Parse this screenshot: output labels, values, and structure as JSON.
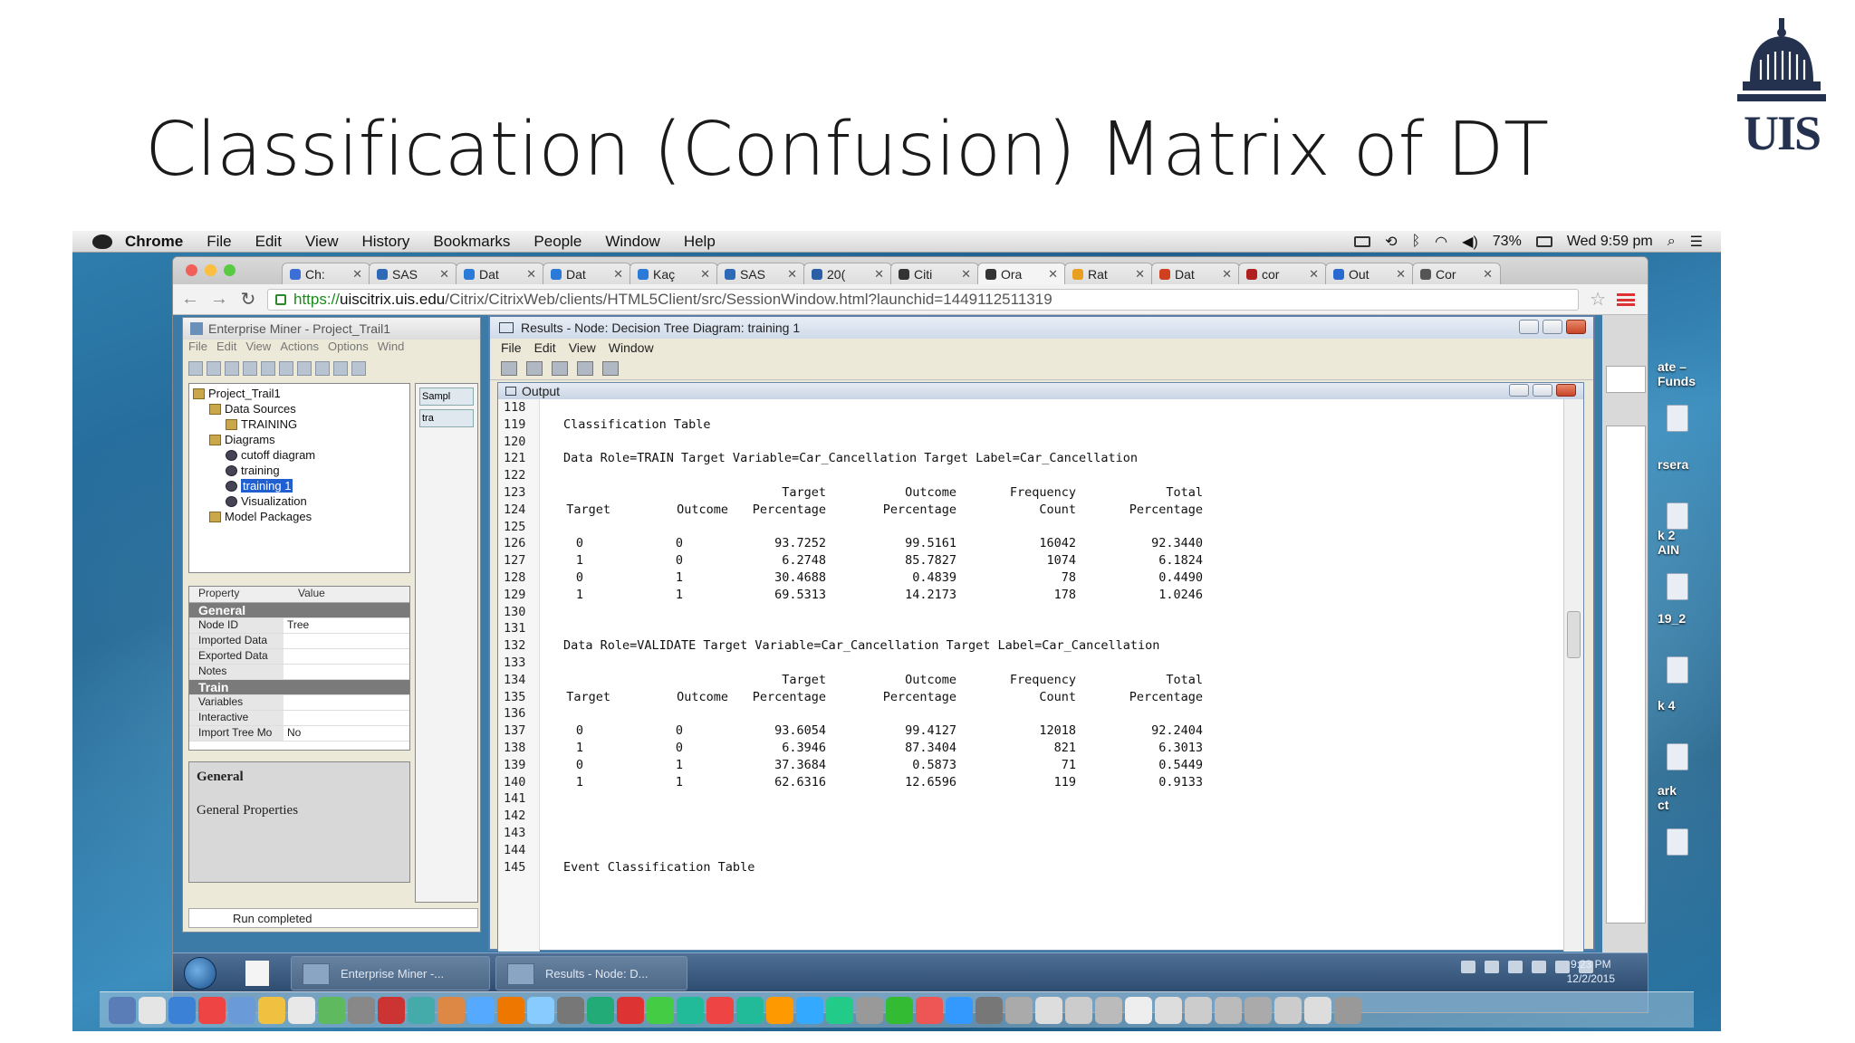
{
  "slide": {
    "title": "Classification (Confusion) Matrix of DT",
    "logo_text": "UIS"
  },
  "mac_menubar": {
    "app": "Chrome",
    "items": [
      "File",
      "Edit",
      "View",
      "History",
      "Bookmarks",
      "People",
      "Window",
      "Help"
    ],
    "battery": "73%",
    "clock": "Wed 9:59 pm"
  },
  "chrome": {
    "tabs": [
      {
        "label": "Ch:",
        "color": "#3b6fd6"
      },
      {
        "label": "SAS",
        "color": "#2c6ab8"
      },
      {
        "label": "Dat",
        "color": "#2a7ad8"
      },
      {
        "label": "Dat",
        "color": "#2a7ad8"
      },
      {
        "label": "Kaç",
        "color": "#2a7ad8"
      },
      {
        "label": "SAS",
        "color": "#2c6ab8"
      },
      {
        "label": "20(",
        "color": "#2a5fa8"
      },
      {
        "label": "Citi",
        "color": "#333333"
      },
      {
        "label": "Ora",
        "color": "#333333"
      },
      {
        "label": "Rat",
        "color": "#e8a020"
      },
      {
        "label": "Dat",
        "color": "#d04020"
      },
      {
        "label": "cor",
        "color": "#b02020"
      },
      {
        "label": "Out",
        "color": "#2a6ad0"
      },
      {
        "label": "Cor",
        "color": "#555555"
      }
    ],
    "active_tab_index": 8,
    "url_https": "https://",
    "url_domain": "uiscitrix.uis.edu",
    "url_rest": "/Citrix/CitrixWeb/clients/HTML5Client/src/SessionWindow.html?launchid=1449112511319"
  },
  "em": {
    "title": "Enterprise Miner - Project_Trail1",
    "menu": [
      "File",
      "Edit",
      "View",
      "Actions",
      "Options",
      "Wind"
    ],
    "tree": [
      {
        "label": "Project_Trail1",
        "indent": 0,
        "gear": false,
        "selected": false
      },
      {
        "label": "Data Sources",
        "indent": 1,
        "gear": false,
        "selected": false
      },
      {
        "label": "TRAINING",
        "indent": 2,
        "gear": false,
        "selected": false
      },
      {
        "label": "Diagrams",
        "indent": 1,
        "gear": false,
        "selected": false
      },
      {
        "label": "cutoff diagram",
        "indent": 2,
        "gear": true,
        "selected": false
      },
      {
        "label": "training",
        "indent": 2,
        "gear": true,
        "selected": false
      },
      {
        "label": "training 1",
        "indent": 2,
        "gear": true,
        "selected": true
      },
      {
        "label": "Visualization",
        "indent": 2,
        "gear": true,
        "selected": false
      },
      {
        "label": "Model Packages",
        "indent": 1,
        "gear": false,
        "selected": false
      }
    ],
    "props_header": {
      "property": "Property",
      "value": "Value"
    },
    "props": [
      {
        "k": "General",
        "v": "",
        "section": true
      },
      {
        "k": "Node ID",
        "v": "Tree",
        "section": false
      },
      {
        "k": "Imported Data",
        "v": "",
        "section": false
      },
      {
        "k": "Exported Data",
        "v": "",
        "section": false
      },
      {
        "k": "Notes",
        "v": "",
        "section": false
      },
      {
        "k": "Train",
        "v": "",
        "section": true
      },
      {
        "k": "Variables",
        "v": "",
        "section": false
      },
      {
        "k": "Interactive",
        "v": "",
        "section": false
      },
      {
        "k": "Import Tree Mo",
        "v": "No",
        "section": false
      }
    ],
    "general_heading": "General",
    "general_sub": "General Properties",
    "status": "Run completed",
    "diagram_tabs": [
      "Sampl",
      "tra"
    ]
  },
  "results": {
    "title": "Results - Node: Decision Tree Diagram: training 1",
    "menu": [
      "File",
      "Edit",
      "View",
      "Window"
    ],
    "output_title": "Output"
  },
  "output": {
    "header_cols": {
      "target": "Target",
      "outcome": "Outcome",
      "target_pct": [
        "Target",
        "Percentage"
      ],
      "outcome_pct": [
        "Outcome",
        "Percentage"
      ],
      "freq": [
        "Frequency",
        "Count"
      ],
      "total_pct": [
        "Total",
        "Percentage"
      ]
    },
    "lines": [
      {
        "n": "118",
        "text": ""
      },
      {
        "n": "119",
        "text": "Classification Table"
      },
      {
        "n": "120",
        "text": ""
      },
      {
        "n": "121",
        "text": "Data Role=TRAIN Target Variable=Car_Cancellation Target Label=Car_Cancellation"
      },
      {
        "n": "122",
        "text": ""
      },
      {
        "n": "123",
        "header": 1
      },
      {
        "n": "124",
        "header": 2
      },
      {
        "n": "125",
        "text": ""
      },
      {
        "n": "126",
        "row": [
          "0",
          "0",
          "93.7252",
          "99.5161",
          "16042",
          "92.3440"
        ]
      },
      {
        "n": "127",
        "row": [
          "1",
          "0",
          "6.2748",
          "85.7827",
          "1074",
          "6.1824"
        ]
      },
      {
        "n": "128",
        "row": [
          "0",
          "1",
          "30.4688",
          "0.4839",
          "78",
          "0.4490"
        ]
      },
      {
        "n": "129",
        "row": [
          "1",
          "1",
          "69.5313",
          "14.2173",
          "178",
          "1.0246"
        ]
      },
      {
        "n": "130",
        "text": ""
      },
      {
        "n": "131",
        "text": ""
      },
      {
        "n": "132",
        "text": "Data Role=VALIDATE Target Variable=Car_Cancellation Target Label=Car_Cancellation"
      },
      {
        "n": "133",
        "text": ""
      },
      {
        "n": "134",
        "header": 1
      },
      {
        "n": "135",
        "header": 2
      },
      {
        "n": "136",
        "text": ""
      },
      {
        "n": "137",
        "row": [
          "0",
          "0",
          "93.6054",
          "99.4127",
          "12018",
          "92.2404"
        ]
      },
      {
        "n": "138",
        "row": [
          "1",
          "0",
          "6.3946",
          "87.3404",
          "821",
          "6.3013"
        ]
      },
      {
        "n": "139",
        "row": [
          "0",
          "1",
          "37.3684",
          "0.5873",
          "71",
          "0.5449"
        ]
      },
      {
        "n": "140",
        "row": [
          "1",
          "1",
          "62.6316",
          "12.6596",
          "119",
          "0.9133"
        ]
      },
      {
        "n": "141",
        "text": ""
      },
      {
        "n": "142",
        "text": ""
      },
      {
        "n": "143",
        "text": ""
      },
      {
        "n": "144",
        "text": ""
      },
      {
        "n": "145",
        "text": "Event Classification Table"
      }
    ]
  },
  "taskbar": {
    "items": [
      {
        "label": "Enterprise Miner -..."
      },
      {
        "label": "Results - Node: D..."
      }
    ],
    "time": "9:23 PM",
    "date": "12/2/2015"
  },
  "desktop_labels": [
    {
      "text": "ate –\nFunds"
    },
    {
      "text": "rsera"
    },
    {
      "text": "k 2\nAIN"
    },
    {
      "text": "19_2"
    },
    {
      "text": "k 4"
    },
    {
      "text": "ark\nct"
    }
  ]
}
